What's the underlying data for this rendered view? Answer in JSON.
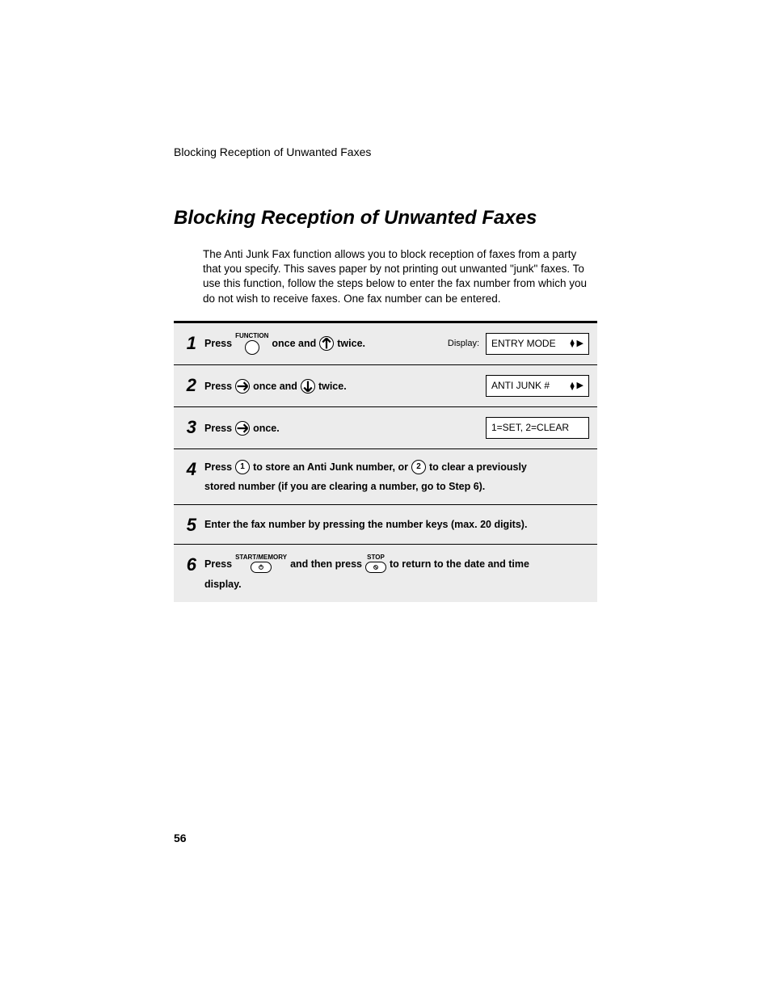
{
  "running_header": "Blocking Reception of Unwanted Faxes",
  "title": "Blocking Reception of Unwanted Faxes",
  "intro": "The Anti Junk Fax function allows you to block reception of faxes from a party that you specify. This saves paper by not printing out unwanted \"junk\" faxes. To use this function, follow the steps below to enter the fax number from which you do not wish to receive faxes. One fax number can be entered.",
  "display_label": "Display:",
  "steps": {
    "s1": {
      "num": "1",
      "p1": "Press",
      "key_label": "FUNCTION",
      "p2": "once and",
      "p3": "twice.",
      "display": "ENTRY MODE"
    },
    "s2": {
      "num": "2",
      "p1": "Press",
      "p2": "once and",
      "p3": "twice.",
      "display": "ANTI JUNK #"
    },
    "s3": {
      "num": "3",
      "p1": "Press",
      "p2": "once.",
      "display": "1=SET, 2=CLEAR"
    },
    "s4": {
      "num": "4",
      "p1": "Press",
      "k1": "1",
      "p2": "to store an Anti Junk number, or",
      "k2": "2",
      "p3": "to clear a previously",
      "p4": "stored number (if you are clearing a number, go to Step 6)."
    },
    "s5": {
      "num": "5",
      "p1": "Enter the fax number by pressing the number keys (max. 20 digits)."
    },
    "s6": {
      "num": "6",
      "p1": "Press",
      "k1_label": "START/MEMORY",
      "p2": "and then press",
      "k2_label": "STOP",
      "p3": "to return to the date and time",
      "p4": "display."
    }
  },
  "page_number": "56"
}
